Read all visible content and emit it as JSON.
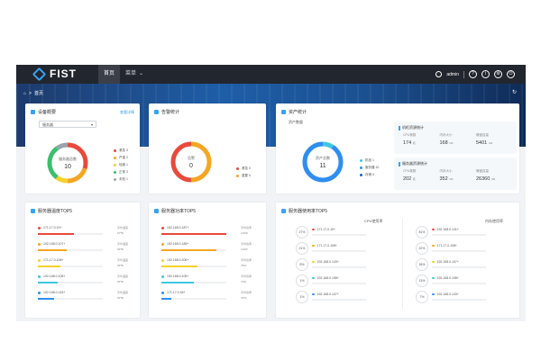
{
  "app": {
    "logo_text": "FIST",
    "nav": [
      {
        "label": "首页",
        "active": true
      },
      {
        "label": "菜单",
        "active": false
      }
    ],
    "user": "admin",
    "top_icons": [
      "help-icon",
      "info-icon",
      "settings-icon",
      "logout-icon"
    ]
  },
  "breadcrumb": {
    "home_icon": "home-icon",
    "sep": ">",
    "current": "首页"
  },
  "device_card": {
    "title": "设备概要",
    "link": "查看详情",
    "select_value": "服务器",
    "donut": {
      "label": "服务器总数",
      "value": "10"
    },
    "legend": [
      {
        "label": "紧急 3",
        "color": "#e84a3c"
      },
      {
        "label": "严重 2",
        "color": "#f5a623"
      },
      {
        "label": "轻微 1",
        "color": "#f7d12b"
      },
      {
        "label": "正常 3",
        "color": "#3bbf6e"
      },
      {
        "label": "未知 1",
        "color": "#9aa3ae"
      }
    ],
    "segments": [
      {
        "value": 3,
        "color": "#e84a3c"
      },
      {
        "value": 2,
        "color": "#f5a623"
      },
      {
        "value": 1,
        "color": "#f7d12b"
      },
      {
        "value": 3,
        "color": "#3bbf6e"
      },
      {
        "value": 1,
        "color": "#9aa3ae"
      }
    ]
  },
  "alert_card": {
    "title": "告警统计",
    "donut": {
      "label": "告警",
      "value": "0"
    },
    "legend": [
      {
        "label": "紧急 0",
        "color": "#e84a3c"
      },
      {
        "label": "重要 0",
        "color": "#f5a623"
      }
    ],
    "segments": [
      {
        "value": 1,
        "color": "#f5a623"
      },
      {
        "value": 1,
        "color": "#e84a3c"
      }
    ]
  },
  "asset_card": {
    "title": "资产统计",
    "subtitle": "资产数量",
    "donut": {
      "label": "资产总数",
      "value": "11"
    },
    "legend": [
      {
        "label": "机柜 1",
        "color": "#3fc7e0"
      },
      {
        "label": "服务器 10",
        "color": "#2f8ef0"
      },
      {
        "label": "存储 0",
        "color": "#1f5fc4"
      }
    ],
    "segments": [
      {
        "value": 1,
        "color": "#3fc7e0"
      },
      {
        "value": 10,
        "color": "#2f8ef0"
      }
    ],
    "stats": [
      {
        "title": "机柜资源统计",
        "cols": [
          {
            "label": "CPU核数",
            "value": "174",
            "unit": "核"
          },
          {
            "label": "内存大小",
            "value": "168",
            "unit": "GB"
          },
          {
            "label": "硬盘容量",
            "value": "5401",
            "unit": "GB"
          }
        ]
      },
      {
        "title": "服务器资源统计",
        "cols": [
          {
            "label": "CPU核数",
            "value": "202",
            "unit": "核"
          },
          {
            "label": "内存大小",
            "value": "352",
            "unit": "GB"
          },
          {
            "label": "硬盘容量",
            "value": "26360",
            "unit": "GB"
          }
        ]
      }
    ]
  },
  "temp_card": {
    "title": "服务器温度TOP5",
    "rows": [
      {
        "ip": "171.17.0.19+",
        "color": "#e84a3c",
        "fill": 0.55,
        "meta1": "平均温度",
        "meta2": "57℃"
      },
      {
        "ip": "192.168.0.107+",
        "color": "#f5a623",
        "fill": 0.45,
        "meta1": "平均温度",
        "meta2": "56℃"
      },
      {
        "ip": "171.17.0.108+",
        "color": "#f7d12b",
        "fill": 0.35,
        "meta1": "平均温度",
        "meta2": "55℃"
      },
      {
        "ip": "192.168.0.108+",
        "color": "#3fc7e0",
        "fill": 0.3,
        "meta1": "平均温度",
        "meta2": "54℃"
      },
      {
        "ip": "192.168.0.143+",
        "color": "#2f8ef0",
        "fill": 0.25,
        "meta1": "平均温度",
        "meta2": "53℃"
      }
    ]
  },
  "power_card": {
    "title": "服务器功率TOP5",
    "rows": [
      {
        "ip": "192.168.0.187+",
        "color": "#e84a3c",
        "fill": 1.0,
        "meta1": "平均功率",
        "meta2": "120W"
      },
      {
        "ip": "192.168.0.185+",
        "color": "#f5a623",
        "fill": 0.85,
        "meta1": "平均功率",
        "meta2": "110W"
      },
      {
        "ip": "192.168.0.206+",
        "color": "#f7d12b",
        "fill": 0.55,
        "meta1": "平均功率",
        "meta2": "75W"
      },
      {
        "ip": "192.168.0.105+",
        "color": "#3fc7e0",
        "fill": 0.5,
        "meta1": "平均功率",
        "meta2": "70W"
      },
      {
        "ip": "171.17.0.18+",
        "color": "#2f8ef0",
        "fill": 0.15,
        "meta1": "平均功率",
        "meta2": "47W"
      }
    ]
  },
  "usage_card": {
    "title": "服务器使用率TOP5",
    "left_head": "CPU使用率",
    "right_head": "内存使用率",
    "left": [
      {
        "pct": "27%",
        "ip": "171.17.0.19+",
        "color": "#e84a3c"
      },
      {
        "pct": "21%",
        "ip": "171.17.0.108+",
        "color": "#f5a623"
      },
      {
        "pct": "8%",
        "ip": "192.168.0.143+",
        "color": "#f7d12b"
      },
      {
        "pct": "1%",
        "ip": "192.168.0.198+",
        "color": "#3fc7e0"
      },
      {
        "pct": "1%",
        "ip": "192.168.0.107+",
        "color": "#2f8ef0"
      }
    ],
    "right": [
      {
        "pct": "81%",
        "ip": "192.168.0.141+",
        "color": "#e84a3c"
      },
      {
        "pct": "22%",
        "ip": "171.17.0.108+",
        "color": "#f5a623"
      },
      {
        "pct": "18%",
        "ip": "192.168.0.107+",
        "color": "#f7d12b"
      },
      {
        "pct": "13%",
        "ip": "192.168.0.198+",
        "color": "#3fc7e0"
      },
      {
        "pct": "7%",
        "ip": "192.168.0.143+",
        "color": "#2f8ef0"
      }
    ]
  }
}
